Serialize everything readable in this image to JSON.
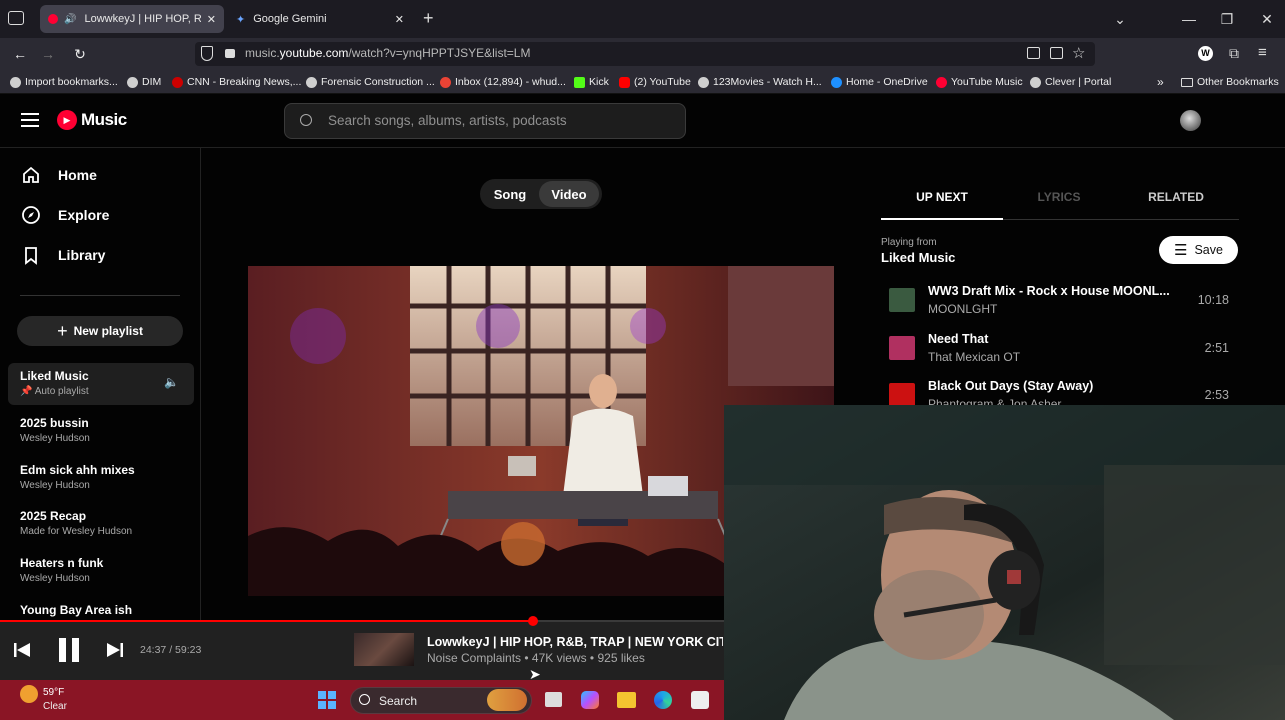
{
  "browser": {
    "tabs": [
      {
        "label": "LowwkeyJ | HIP HOP, R&B,",
        "close": "✕"
      },
      {
        "label": "Google Gemini",
        "close": "✕"
      }
    ],
    "new_tab": "+",
    "url_prefix": "music.",
    "url_domain": "youtube.com",
    "url_path": "/watch?v=ynqHPPTJSYE&list=LM",
    "bookmarks": [
      {
        "label": "Import bookmarks...",
        "color": "#cfcfcf"
      },
      {
        "label": "DIM",
        "color": "#cfcfcf"
      },
      {
        "label": "CNN - Breaking News,...",
        "color": "#cc0000"
      },
      {
        "label": "Forensic Construction ...",
        "color": "#cfcfcf"
      },
      {
        "label": "Inbox (12,894) - whud...",
        "color": "#ea4335"
      },
      {
        "label": "Kick",
        "color": "#53fc18"
      },
      {
        "label": "(2) YouTube",
        "color": "#ff0000"
      },
      {
        "label": "123Movies - Watch H...",
        "color": "#cfcfcf"
      },
      {
        "label": "Home - OneDrive",
        "color": "#1e90ff"
      },
      {
        "label": "YouTube Music",
        "color": "#ff0033"
      },
      {
        "label": "Clever | Portal",
        "color": "#cfcfcf"
      }
    ],
    "other_bookmarks": "Other Bookmarks"
  },
  "ytm": {
    "logo": "Music",
    "search_placeholder": "Search songs, albums, artists, podcasts",
    "nav": [
      {
        "label": "Home",
        "icon": "home-icon"
      },
      {
        "label": "Explore",
        "icon": "explore-icon"
      },
      {
        "label": "Library",
        "icon": "library-icon"
      }
    ],
    "new_playlist": "New playlist",
    "playlists": [
      {
        "title": "Liked Music",
        "subtitle": "Auto playlist"
      },
      {
        "title": "2025 bussin",
        "subtitle": "Wesley Hudson"
      },
      {
        "title": "Edm sick ahh mixes",
        "subtitle": "Wesley Hudson"
      },
      {
        "title": "2025 Recap",
        "subtitle": "Made for Wesley Hudson"
      },
      {
        "title": "Heaters n funk",
        "subtitle": "Wesley Hudson"
      },
      {
        "title": "Young Bay Area ish",
        "subtitle": ""
      }
    ],
    "toggle": {
      "song": "Song",
      "video": "Video",
      "selected": "Video"
    },
    "right_tabs": [
      "UP NEXT",
      "LYRICS",
      "RELATED"
    ],
    "playing_from_label": "Playing from",
    "playing_from": "Liked Music",
    "save": "Save",
    "queue": [
      {
        "title": "WW3 Draft Mix - Rock x House MOONL...",
        "artist": "MOONLGHT",
        "duration": "10:18",
        "thumb": "#3a5a40"
      },
      {
        "title": "Need That",
        "artist": "That Mexican OT",
        "duration": "2:51",
        "thumb": "#b03060"
      },
      {
        "title": "Black Out Days (Stay Away)",
        "artist": "Phantogram & Jon Asher",
        "duration": "2:53",
        "thumb": "#cc1111"
      }
    ]
  },
  "player": {
    "time": "24:37 / 59:23",
    "progress": 0.4145,
    "title": "LowwkeyJ | HIP HOP, R&B, TRAP | NEW YORK CIT",
    "meta": "Noise Complaints • 47K views • 925 likes"
  },
  "taskbar": {
    "temp": "59°F",
    "condition": "Clear",
    "search": "Search"
  }
}
